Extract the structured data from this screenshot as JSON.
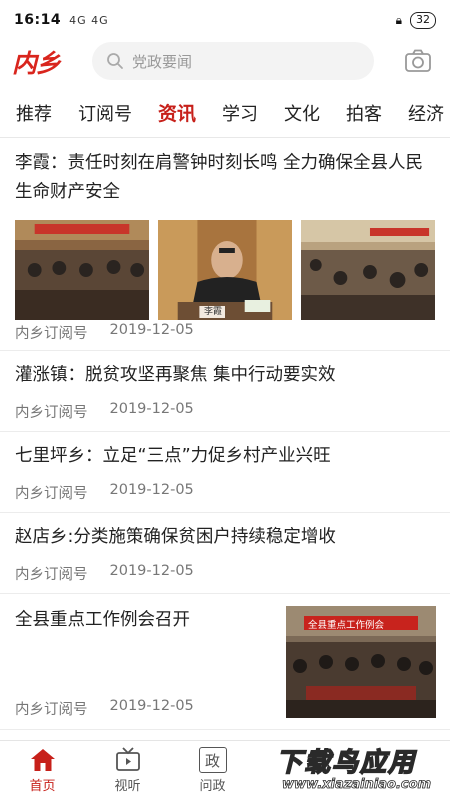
{
  "status_bar": {
    "time": "16:14",
    "signal": "4G 4G",
    "battery": "32"
  },
  "header": {
    "logo": "内乡",
    "search_placeholder": "党政要闻"
  },
  "tabs": [
    "推荐",
    "订阅号",
    "资讯",
    "学习",
    "文化",
    "拍客",
    "经济"
  ],
  "active_tab": "资讯",
  "articles": [
    {
      "title": "李霞：责任时刻在肩警钟时刻长鸣 全力确保全县人民生命财产安全",
      "source": "内乡订阅号",
      "date": "2019-12-05",
      "image_captions": [
        "",
        "李霞",
        ""
      ]
    },
    {
      "title": "灌涨镇：脱贫攻坚再聚焦 集中行动要实效",
      "source": "内乡订阅号",
      "date": "2019-12-05"
    },
    {
      "title": "七里坪乡：立足“三点”力促乡村产业兴旺",
      "source": "内乡订阅号",
      "date": "2019-12-05"
    },
    {
      "title": "赵店乡:分类施策确保贫困户持续稳定增收",
      "source": "内乡订阅号",
      "date": "2019-12-05"
    },
    {
      "title": "全县重点工作例会召开",
      "source": "内乡订阅号",
      "date": "2019-12-05",
      "image_banner": "全县重点工作例会"
    }
  ],
  "bottom_nav": [
    {
      "label": "首页",
      "icon": "home-icon",
      "active": true
    },
    {
      "label": "视听",
      "icon": "tv-icon",
      "active": false
    },
    {
      "label": "问政",
      "icon": "zheng-icon",
      "icon_text": "政",
      "active": false
    }
  ],
  "watermark": {
    "big": "下载鸟应用",
    "small": "www.xiazainiao.com"
  },
  "colors": {
    "accent": "#c7201a",
    "logo": "#d9251d"
  }
}
